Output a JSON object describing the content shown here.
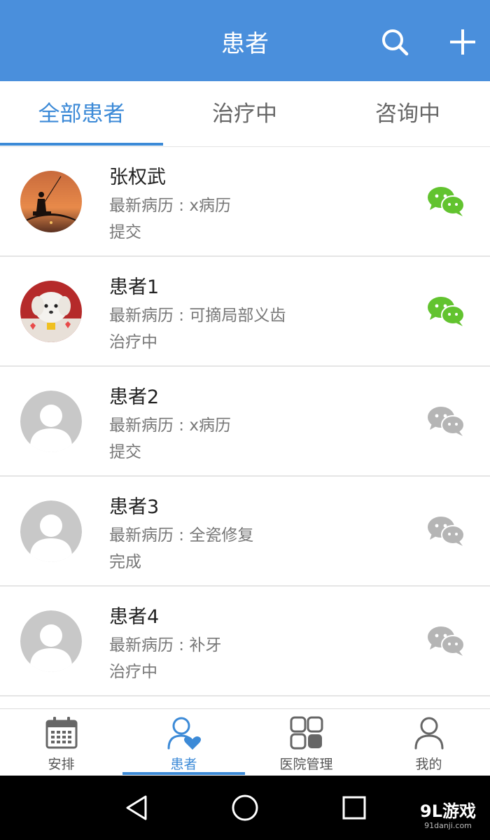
{
  "header": {
    "title": "患者",
    "search_icon": "search-icon",
    "add_icon": "plus-icon",
    "bg_color": "#4a8fdc"
  },
  "tabs": [
    {
      "label": "全部患者",
      "active": true
    },
    {
      "label": "治疗中",
      "active": false
    },
    {
      "label": "咨询中",
      "active": false
    }
  ],
  "patients": [
    {
      "name": "张权武",
      "record": "最新病历 : x病历",
      "status": "提交",
      "avatar": "fishing-silhouette-photo",
      "wechat_active": true
    },
    {
      "name": "患者1",
      "record": "最新病历 : 可摘局部义齿",
      "status": "治疗中",
      "avatar": "white-puppy-photo",
      "wechat_active": true
    },
    {
      "name": "患者2",
      "record": "最新病历 : x病历",
      "status": "提交",
      "avatar": "default-person",
      "wechat_active": false
    },
    {
      "name": "患者3",
      "record": "最新病历 : 全瓷修复",
      "status": "完成",
      "avatar": "default-person",
      "wechat_active": false
    },
    {
      "name": "患者4",
      "record": "最新病历 : 补牙",
      "status": "治疗中",
      "avatar": "default-person",
      "wechat_active": false
    }
  ],
  "bottom_nav": [
    {
      "label": "安排",
      "icon": "calendar-icon",
      "active": false
    },
    {
      "label": "患者",
      "icon": "patient-heart-icon",
      "active": true
    },
    {
      "label": "医院管理",
      "icon": "grid-icon",
      "active": false
    },
    {
      "label": "我的",
      "icon": "person-icon",
      "active": false
    }
  ],
  "system_nav": {
    "back_icon": "back-triangle-icon",
    "home_icon": "home-circle-icon",
    "recent_icon": "recent-square-icon"
  },
  "watermark": {
    "main": "9L游戏",
    "sub": "91danji.com"
  },
  "colors": {
    "accent": "#3c8ad7",
    "wechat_active": "#62c32f",
    "wechat_inactive": "#b5b5b5",
    "default_avatar": "#c8c8c8"
  }
}
